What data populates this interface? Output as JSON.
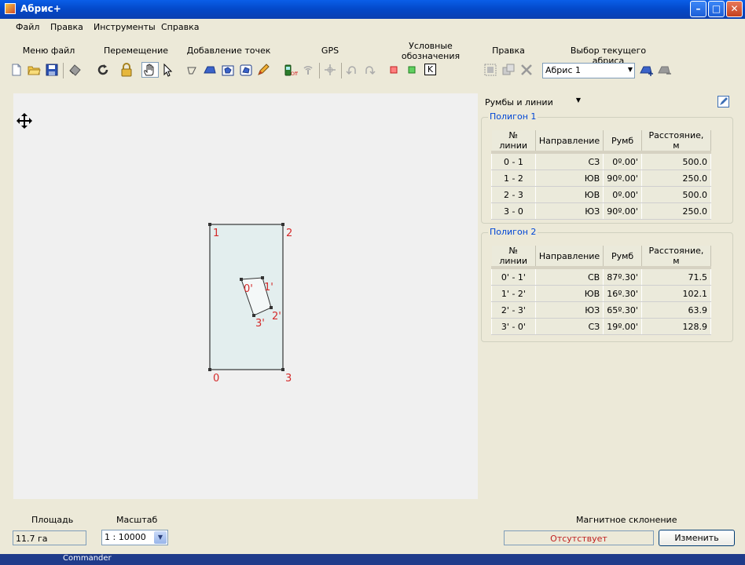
{
  "window": {
    "title": "Абрис+",
    "controls": {
      "minimize": "–",
      "maximize": "□",
      "close": "✕"
    }
  },
  "menu": [
    "Файл",
    "Правка",
    "Инструменты",
    "Справка"
  ],
  "toolbar": {
    "groups": {
      "file": "Меню файл",
      "move": "Перемещение",
      "add_points": "Добавление точек",
      "gps": "GPS",
      "legend_line1": "Условные",
      "legend_line2": "обозначения",
      "edit": "Правка",
      "select": "Выбор текущего абриса"
    },
    "legend_k": "K",
    "abris_select": {
      "value": "Абрис 1"
    }
  },
  "panel": {
    "view_select": {
      "value": "Румбы и линии"
    },
    "table_headers": [
      "№ линии",
      "Направление",
      "Румб",
      "Расстояние, м"
    ],
    "polygons": [
      {
        "title": "Полигон 1",
        "rows": [
          {
            "line": "0 - 1",
            "direction": "СЗ",
            "rumb": "0º.00'",
            "distance": "500.0"
          },
          {
            "line": "1 - 2",
            "direction": "ЮВ",
            "rumb": "90º.00'",
            "distance": "250.0"
          },
          {
            "line": "2 - 3",
            "direction": "ЮВ",
            "rumb": "0º.00'",
            "distance": "500.0"
          },
          {
            "line": "3 - 0",
            "direction": "ЮЗ",
            "rumb": "90º.00'",
            "distance": "250.0"
          }
        ]
      },
      {
        "title": "Полигон 2",
        "rows": [
          {
            "line": "0' - 1'",
            "direction": "СВ",
            "rumb": "87º.30'",
            "distance": "71.5"
          },
          {
            "line": "1' - 2'",
            "direction": "ЮВ",
            "rumb": "16º.30'",
            "distance": "102.1"
          },
          {
            "line": "2' - 3'",
            "direction": "ЮЗ",
            "rumb": "65º.30'",
            "distance": "63.9"
          },
          {
            "line": "3' - 0'",
            "direction": "СЗ",
            "rumb": "19º.00'",
            "distance": "128.9"
          }
        ]
      }
    ]
  },
  "canvas": {
    "outer_labels": [
      "0",
      "1",
      "2",
      "3"
    ],
    "inner_labels": [
      "0'",
      "1'",
      "2'",
      "3'"
    ]
  },
  "status": {
    "area_label": "Площадь",
    "area_value": "11.7 га",
    "scale_label": "Масштаб",
    "scale_value": "1 : 10000",
    "magnetic_label": "Магнитное склонение",
    "magnetic_value": "Отсутствует",
    "change_button": "Изменить"
  },
  "taskbar": {
    "text": "Commander"
  },
  "colors": {
    "accent_blue": "#0046d5",
    "vertex_red": "#d42a2a",
    "polygon_fill": "#e3eeee"
  }
}
